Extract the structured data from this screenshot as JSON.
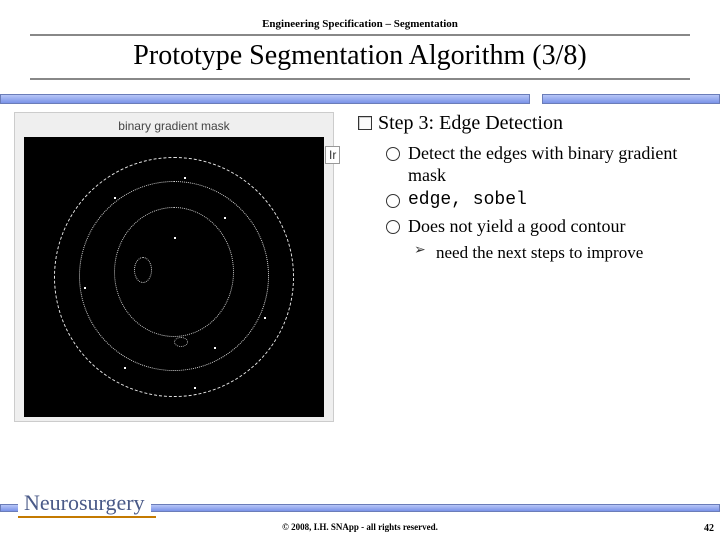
{
  "header": {
    "subtitle": "Engineering Specification – Segmentation",
    "title": "Prototype Segmentation Algorithm (3/8)"
  },
  "figure": {
    "caption": "binary gradient mask",
    "corner_label": "Ir"
  },
  "content": {
    "step_heading": "Step 3: Edge Detection",
    "bullets": [
      "Detect the edges with binary gradient mask",
      "edge, sobel",
      "Does not yield a good contour"
    ],
    "sub_bullet": "need the next steps to improve"
  },
  "footer": {
    "logo": "Neurosurgery",
    "copyright": "© 2008, I.H. SNApp - all rights reserved.",
    "page": "42"
  }
}
